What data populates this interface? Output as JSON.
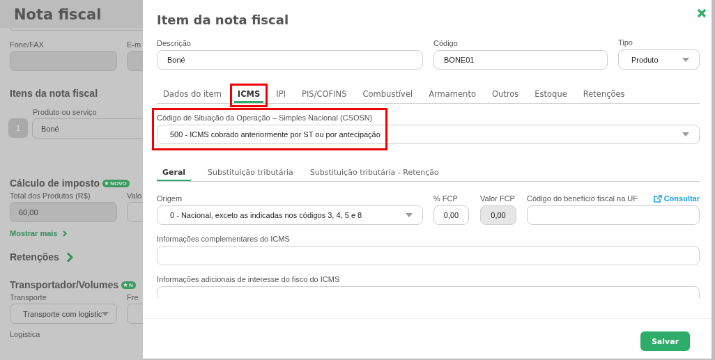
{
  "page": {
    "title": "Nota fiscal",
    "contact_labels": [
      "Fone/FAX",
      "E-m"
    ],
    "items_heading": "Itens da nota fiscal",
    "item_label": "Produto ou serviço",
    "item_number": "1",
    "item_value": "Boné",
    "tax_heading": "Cálculo de imposto",
    "tax_badge": "NOVO",
    "tax_labels": [
      "Total dos Produtos (R$)",
      "Valo"
    ],
    "tax_value": "60,00",
    "show_more": "Mostrar mais",
    "retention_heading": "Retenções",
    "transport_heading": "Transportador/Volumes",
    "transport_badge": "N",
    "transport_labels": [
      "Transporte",
      "Fre"
    ],
    "transport_value": "Transporte com logistic",
    "logistics_label": "Logistica"
  },
  "modal": {
    "title": "Item da nota fiscal",
    "description": {
      "label": "Descrição",
      "value": "Boné"
    },
    "code": {
      "label": "Código",
      "value": "BONE01"
    },
    "type": {
      "label": "Tipo",
      "value": "Produto"
    },
    "tabs": [
      {
        "label": "Dados do item",
        "selected": false,
        "highlighted": false
      },
      {
        "label": "ICMS",
        "selected": true,
        "highlighted": true
      },
      {
        "label": "IPI",
        "selected": false,
        "highlighted": false
      },
      {
        "label": "PIS/COFINS",
        "selected": false,
        "highlighted": false
      },
      {
        "label": "Combustível",
        "selected": false,
        "highlighted": false
      },
      {
        "label": "Armamento",
        "selected": false,
        "highlighted": false
      },
      {
        "label": "Outros",
        "selected": false,
        "highlighted": false
      },
      {
        "label": "Estoque",
        "selected": false,
        "highlighted": false
      },
      {
        "label": "Retenções",
        "selected": false,
        "highlighted": false
      }
    ],
    "csosn": {
      "label": "Código de Situação da Operação – Simples Nacional (CSOSN)",
      "value": "500 - ICMS cobrado anteriormente por ST ou por antecipação",
      "highlighted": true
    },
    "subtabs": [
      {
        "label": "Geral",
        "selected": true
      },
      {
        "label": "Substituição tributária",
        "selected": false
      },
      {
        "label": "Substituição tributária - Retenção",
        "selected": false
      }
    ],
    "origin": {
      "label": "Origem",
      "value": "0 - Nacional, exceto as indicadas nos códigos 3, 4, 5 e 8"
    },
    "fcp_percent": {
      "label": "% FCP",
      "value": "0,00",
      "disabled": false
    },
    "fcp_value": {
      "label": "Valor FCP",
      "value": "0,00",
      "disabled": true
    },
    "benefit": {
      "label": "Código do benefício fiscal na UF",
      "link": "Consultar"
    },
    "complementary": {
      "label": "Informações complementares do ICMS"
    },
    "additional": {
      "label": "Informações adicionais de interesse do fisco do ICMS"
    },
    "save": "Salvar"
  }
}
